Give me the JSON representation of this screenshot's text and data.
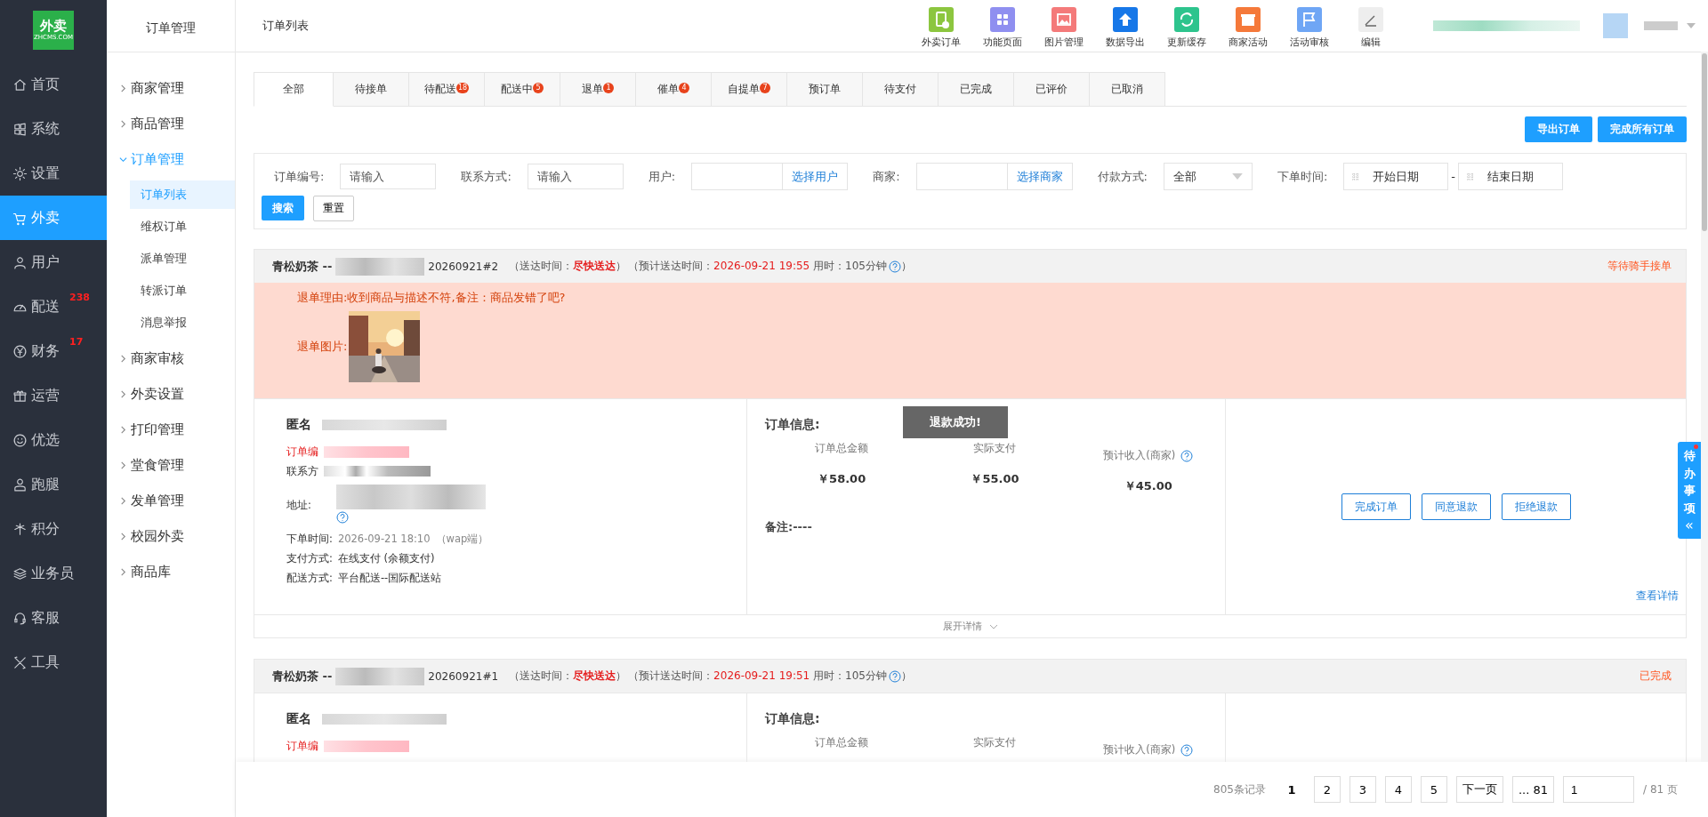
{
  "logo": {
    "text": "外卖",
    "subtext": "ZHCMS.COM"
  },
  "main_nav": [
    {
      "label": "首页",
      "selected": false
    },
    {
      "label": "系统",
      "selected": false
    },
    {
      "label": "设置",
      "selected": false
    },
    {
      "label": "外卖",
      "selected": true
    },
    {
      "label": "用户",
      "selected": false
    },
    {
      "label": "配送",
      "selected": false,
      "badge": "238"
    },
    {
      "label": "财务",
      "selected": false,
      "badge": "17"
    },
    {
      "label": "运营",
      "selected": false
    },
    {
      "label": "优选",
      "selected": false
    },
    {
      "label": "跑腿",
      "selected": false
    },
    {
      "label": "积分",
      "selected": false
    },
    {
      "label": "业务员",
      "selected": false
    },
    {
      "label": "客服",
      "selected": false
    },
    {
      "label": "工具",
      "selected": false
    }
  ],
  "sub_nav": {
    "title": "订单管理",
    "items": [
      {
        "label": "商家管理",
        "expanded": false
      },
      {
        "label": "商品管理",
        "expanded": false
      },
      {
        "label": "订单管理",
        "expanded": true,
        "children": [
          {
            "label": "订单列表",
            "selected": true
          },
          {
            "label": "维权订单",
            "selected": false
          },
          {
            "label": "派单管理",
            "selected": false
          },
          {
            "label": "转派订单",
            "selected": false
          },
          {
            "label": "消息举报",
            "selected": false
          }
        ]
      },
      {
        "label": "商家审核",
        "expanded": false
      },
      {
        "label": "外卖设置",
        "expanded": false
      },
      {
        "label": "打印管理",
        "expanded": false
      },
      {
        "label": "堂食管理",
        "expanded": false
      },
      {
        "label": "发单管理",
        "expanded": false
      },
      {
        "label": "校园外卖",
        "expanded": false
      },
      {
        "label": "商品库",
        "expanded": false
      }
    ]
  },
  "header": {
    "title": "订单列表",
    "tools": [
      "外卖订单",
      "功能页面",
      "图片管理",
      "数据导出",
      "更新缓存",
      "商家活动",
      "活动审核",
      "编辑"
    ]
  },
  "tabs": [
    {
      "label": "全部",
      "selected": true
    },
    {
      "label": "待接单",
      "selected": false
    },
    {
      "label": "待配送",
      "selected": false,
      "badge": "18"
    },
    {
      "label": "配送中",
      "selected": false,
      "badge": "5"
    },
    {
      "label": "退单",
      "selected": false,
      "badge": "1"
    },
    {
      "label": "催单",
      "selected": false,
      "badge": "4"
    },
    {
      "label": "自提单",
      "selected": false,
      "badge": "7"
    },
    {
      "label": "预订单",
      "selected": false
    },
    {
      "label": "待支付",
      "selected": false
    },
    {
      "label": "已完成",
      "selected": false
    },
    {
      "label": "已评价",
      "selected": false
    },
    {
      "label": "已取消",
      "selected": false
    }
  ],
  "actions": [
    "导出订单",
    "完成所有订单"
  ],
  "filters": [
    {
      "kind": "input",
      "label": "订单编号:",
      "placeholder": "请输入"
    },
    {
      "kind": "input",
      "label": "联系方式:",
      "placeholder": "请输入"
    },
    {
      "kind": "picker",
      "label": "用户:",
      "button": "选择用户"
    },
    {
      "kind": "picker",
      "label": "商家:",
      "button": "选择商家"
    },
    {
      "kind": "select",
      "label": "付款方式:",
      "value": "全部"
    },
    {
      "kind": "daterange",
      "label": "下单时间:",
      "start": "开始日期",
      "separator": "-",
      "end": "结束日期"
    }
  ],
  "filter_buttons": {
    "search": "搜索",
    "reset": "重置"
  },
  "orders": [
    {
      "shop": "青松奶茶 --",
      "number": "20260921#2",
      "delivery_prefix": "（送达时间：",
      "delivery_value": "尽快送达",
      "delivery_suffix": "）",
      "eta_prefix": "（预计送达时间：",
      "eta_value": "2026-09-21 19:55",
      "eta_used": " 用时：105分钟",
      "eta_suffix": "）",
      "status": "等待骑手接单",
      "refund": {
        "reason": "退单理由:收到商品与描述不符,备注：商品发错了吧?",
        "image_label": "退单图片:"
      },
      "customer": {
        "name": "匿名",
        "fields": [
          {
            "label": "订单编",
            "kind": "blurred",
            "highlight": true
          },
          {
            "label": "联系方",
            "kind": "blurred",
            "highlight": false
          },
          {
            "label": "地址:",
            "kind": "address",
            "highlight": false
          },
          {
            "label": "下单时间:",
            "kind": "time",
            "value": "2026-09-21 18:10",
            "extra": "（wap端）",
            "highlight": false
          },
          {
            "label": "支付方式:",
            "kind": "text",
            "value": "在线支付 (余额支付)",
            "highlight": false
          },
          {
            "label": "配送方式:",
            "kind": "text",
            "value": "平台配送--国际配送站",
            "highlight": false
          }
        ]
      },
      "info": {
        "title": "订单信息:",
        "amounts": [
          {
            "label": "订单总金额",
            "value": "￥58.00"
          },
          {
            "label": "实际支付",
            "value": "￥55.00"
          },
          {
            "label": "预计收入(商家)",
            "help": true,
            "value": "￥45.00"
          }
        ],
        "note_label": "备注:",
        "note": "----"
      },
      "buttons": [
        "完成订单",
        "同意退款",
        "拒绝退款"
      ],
      "details": "查看详情",
      "expand": "展开详情"
    },
    {
      "shop": "青松奶茶 --",
      "number": "20260921#1",
      "delivery_prefix": "（送达时间：",
      "delivery_value": "尽快送达",
      "delivery_suffix": "）",
      "eta_prefix": "（预计送达时间：",
      "eta_value": "2026-09-21 19:51",
      "eta_used": " 用时：105分钟",
      "eta_suffix": "）",
      "status": "已完成",
      "customer": {
        "name": "匿名",
        "fields": [
          {
            "label": "订单编",
            "kind": "blurred",
            "highlight": true
          }
        ]
      },
      "info": {
        "title": "订单信息:",
        "amounts": [
          {
            "label": "订单总金额"
          },
          {
            "label": "实际支付"
          },
          {
            "label": "预计收入(商家)",
            "help": true
          }
        ]
      }
    }
  ],
  "toast": "退款成功!",
  "todo_tab": "待办事项",
  "todo_arrow": "«",
  "pagination": {
    "total": "805条记录",
    "pages": [
      {
        "label": "1",
        "selected": true
      },
      {
        "label": "2",
        "selected": false
      },
      {
        "label": "3",
        "selected": false
      },
      {
        "label": "4",
        "selected": false
      },
      {
        "label": "5",
        "selected": false
      }
    ],
    "next": "下一页",
    "last": "... 81",
    "page_input": "1",
    "page_total": "/ 81 页"
  }
}
